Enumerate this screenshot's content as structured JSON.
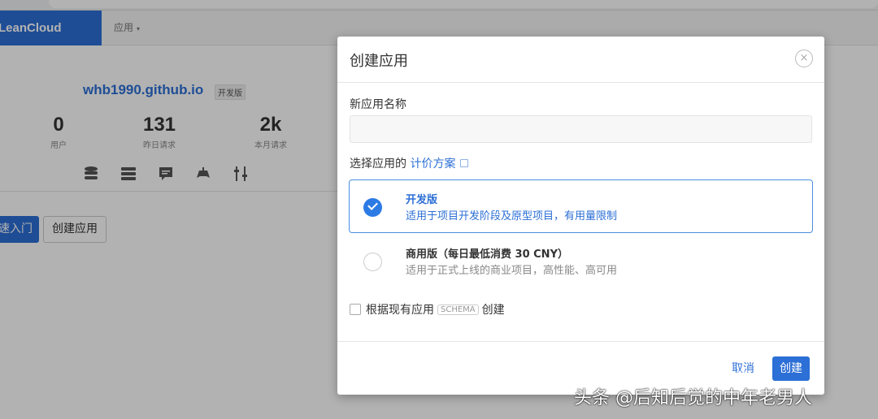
{
  "navbar": {
    "brand": "LeanCloud",
    "apps_menu": "应用",
    "apps_caret": "▾"
  },
  "app_card": {
    "title": "whb1990.github.io",
    "badge": "开发版",
    "stats": [
      {
        "value": "0",
        "label": "用户"
      },
      {
        "value": "131",
        "label": "昨日请求"
      },
      {
        "value": "2k",
        "label": "本月请求"
      }
    ],
    "icons": [
      "database-icon",
      "storage-icon",
      "message-icon",
      "gamepad-icon",
      "settings-sliders-icon"
    ]
  },
  "background_buttons": {
    "quickstart": "速入门",
    "create": "创建应用"
  },
  "modal": {
    "title": "创建应用",
    "close": "×",
    "name_label": "新应用名称",
    "name_value": "",
    "plan_label_prefix": "选择应用的",
    "plan_link": "计价方案",
    "plans": [
      {
        "name": "开发版",
        "desc": "适用于项目开发阶段及原型项目，有用量限制",
        "selected": true
      },
      {
        "name": "商用版（每日最低消费 30 CNY）",
        "desc": "适用于正式上线的商业项目，高性能、高可用",
        "selected": false
      }
    ],
    "schema_prefix": "根据现有应用",
    "schema_tag": "SCHEMA",
    "schema_suffix": "创建",
    "cancel": "取消",
    "create": "创建"
  },
  "watermark": {
    "faint": "后知后觉的中年老男人",
    "main": "头条 @后知后觉的中年老男人"
  },
  "colors": {
    "brand": "#2c6fd6",
    "selected_border": "#4a8ee0",
    "overlay": "rgba(0,0,0,0.3)"
  }
}
